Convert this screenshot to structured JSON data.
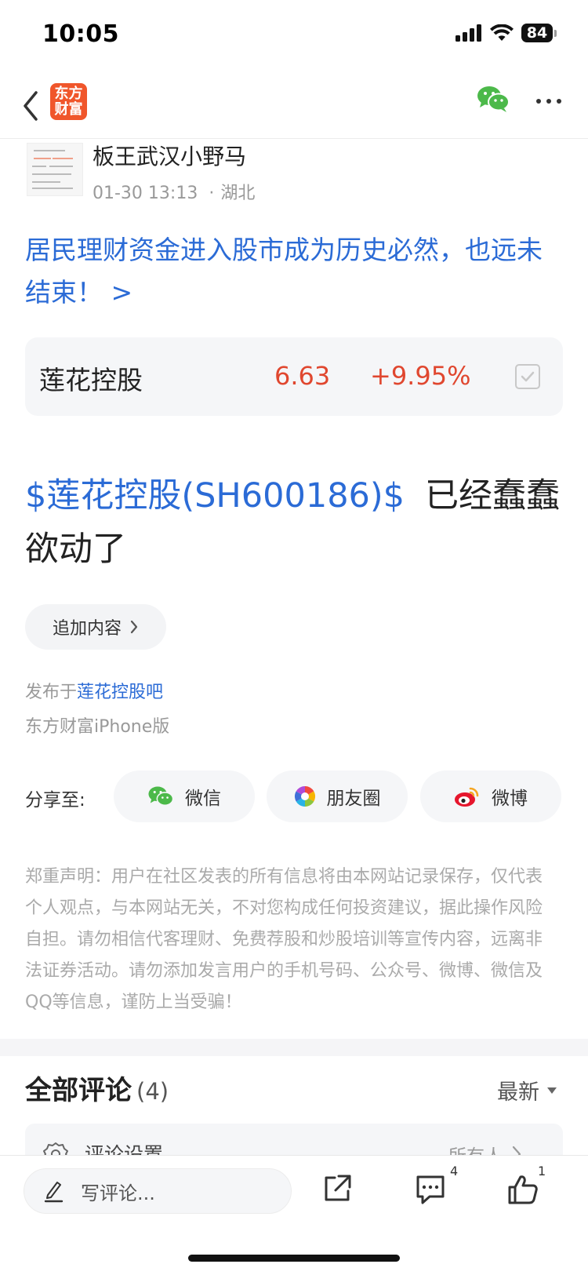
{
  "status_bar": {
    "time": "10:05",
    "battery": "84"
  },
  "nav": {
    "logo_line1": "东方",
    "logo_line2": "财富"
  },
  "author": {
    "name": "板王武汉小野马",
    "date": "01-30 13:13",
    "separator": "·",
    "location": "湖北"
  },
  "post": {
    "title": "居民理财资金进入股市成为历史必然，也远未结束！ >",
    "stock_link": "$莲花控股(SH600186)$",
    "body_text": "已经蠢蠢欲动了",
    "append_label": "追加内容",
    "published_prefix": "发布于",
    "published_forum": "莲花控股吧",
    "source": "东方财富iPhone版"
  },
  "stock_card": {
    "name": "莲花控股",
    "price": "6.63",
    "change": "+9.95%"
  },
  "share": {
    "label": "分享至:",
    "buttons": [
      {
        "label": "微信",
        "icon": "wechat-icon"
      },
      {
        "label": "朋友圈",
        "icon": "moments-icon"
      },
      {
        "label": "微博",
        "icon": "weibo-icon"
      }
    ]
  },
  "disclaimer": "郑重声明：用户在社区发表的所有信息将由本网站记录保存，仅代表个人观点，与本网站无关，不对您构成任何投资建议，据此操作风险自担。请勿相信代客理财、免费荐股和炒股培训等宣传内容，远离非法证券活动。请勿添加发言用户的手机号码、公众号、微博、微信及QQ等信息，谨防上当受骗！",
  "comments": {
    "title": "全部评论",
    "count": "(4)",
    "sort": "最新",
    "settings_label": "评论设置",
    "settings_value": "所有人"
  },
  "bottom_bar": {
    "input_placeholder": "写评论...",
    "comment_badge": "4",
    "like_badge": "1"
  },
  "colors": {
    "link_blue": "#2b6bd6",
    "stock_up_red": "#e0472f",
    "brand_orange": "#f0562b",
    "wechat_green": "#4cb94a"
  }
}
